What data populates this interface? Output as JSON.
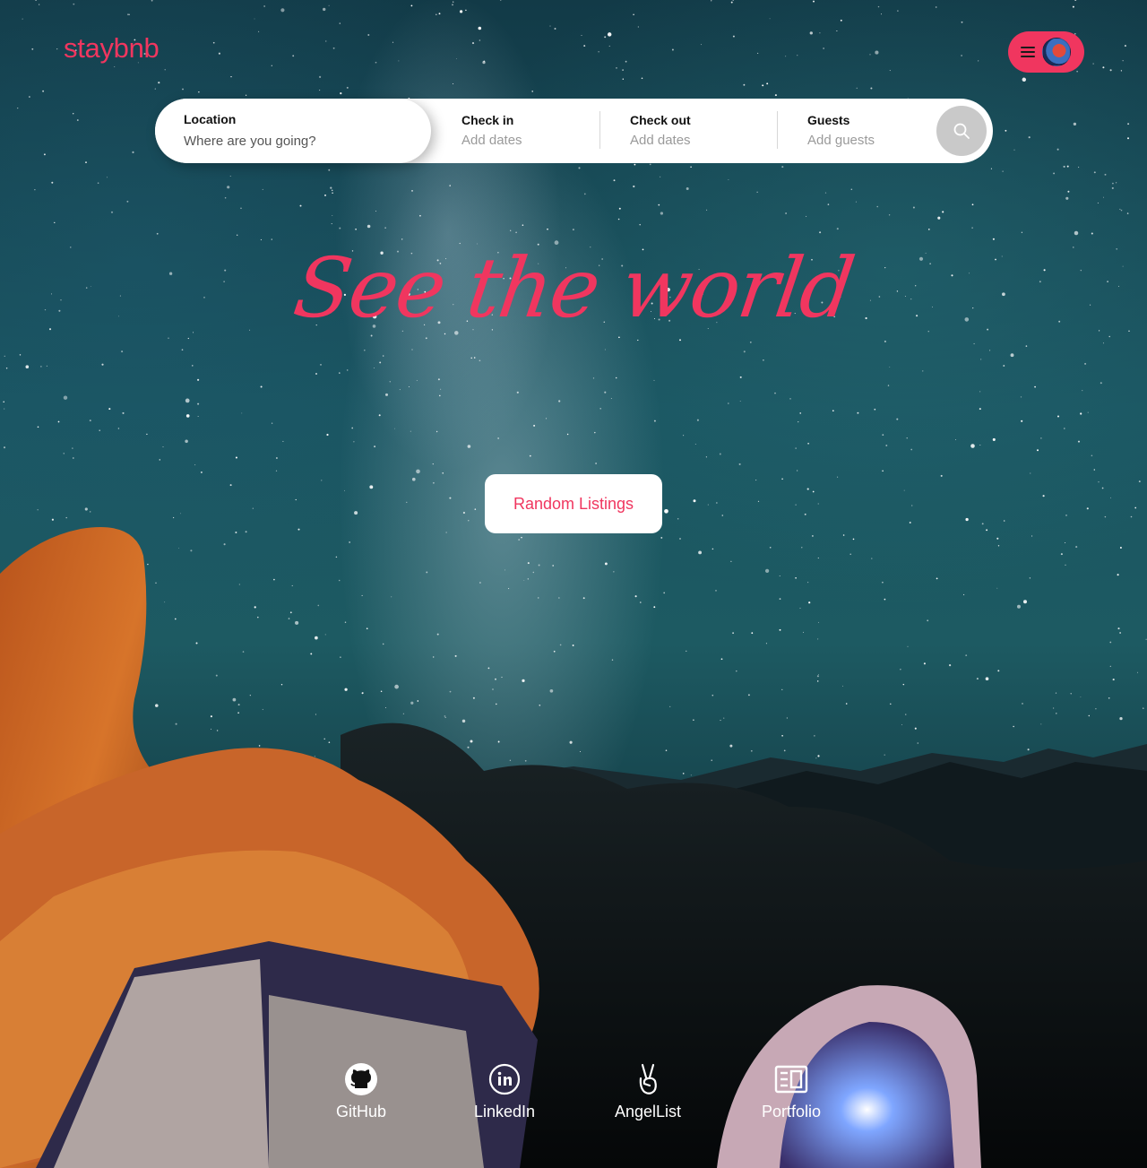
{
  "header": {
    "logo": "staybnb",
    "menu_icon": "hamburger-icon",
    "avatar_icon": "user-avatar"
  },
  "search": {
    "location": {
      "label": "Location",
      "placeholder": "Where are you going?"
    },
    "check_in": {
      "label": "Check in",
      "value": "Add dates"
    },
    "check_out": {
      "label": "Check out",
      "value": "Add dates"
    },
    "guests": {
      "label": "Guests",
      "value": "Add guests"
    },
    "button_icon": "search-icon"
  },
  "hero": {
    "title": "See the world",
    "button_label": "Random Listings"
  },
  "footer": {
    "links": [
      {
        "label": "GitHub",
        "icon": "github-icon"
      },
      {
        "label": "LinkedIn",
        "icon": "linkedin-icon"
      },
      {
        "label": "AngelList",
        "icon": "angellist-icon"
      },
      {
        "label": "Portfolio",
        "icon": "portfolio-icon"
      }
    ]
  },
  "colors": {
    "brand": "#f0365f",
    "search_button": "#c9c9c9",
    "text_muted": "#9a9a9a"
  }
}
